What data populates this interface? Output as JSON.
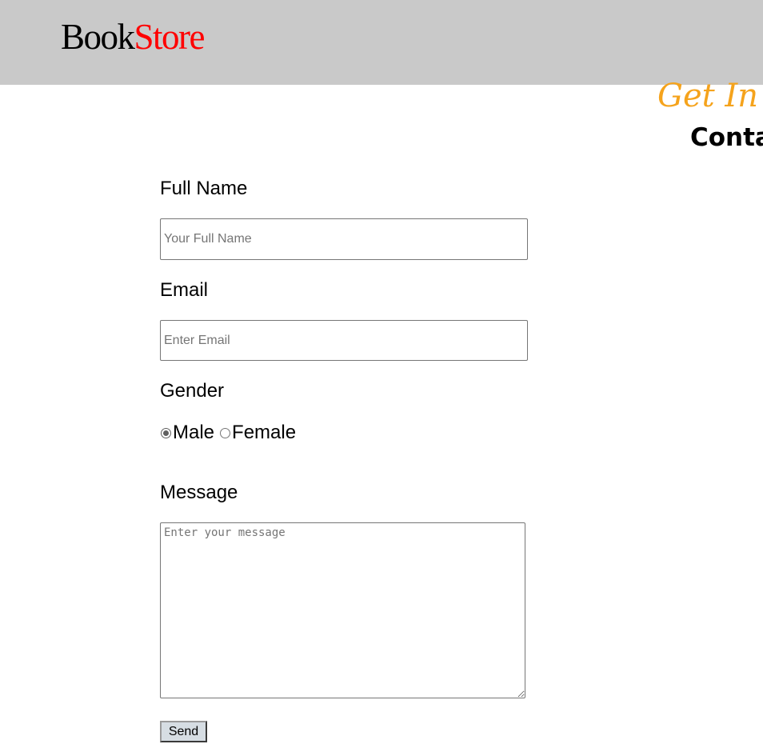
{
  "header": {
    "logo_part1": "Book",
    "logo_part2": "Store",
    "background_color": "#c9c9c9",
    "logo_accent_color": "#ff0000"
  },
  "hero": {
    "tagline": "Get In",
    "heading": "Conta",
    "tagline_color": "#f5a31c"
  },
  "form": {
    "full_name": {
      "label": "Full Name",
      "placeholder": "Your Full Name",
      "value": ""
    },
    "email": {
      "label": "Email",
      "placeholder": "Enter Email",
      "value": ""
    },
    "gender": {
      "label": "Gender",
      "options": [
        {
          "label": "Male",
          "selected": true
        },
        {
          "label": "Female",
          "selected": false
        }
      ]
    },
    "message": {
      "label": "Message",
      "placeholder": "Enter your message",
      "value": ""
    },
    "submit_label": "Send"
  }
}
